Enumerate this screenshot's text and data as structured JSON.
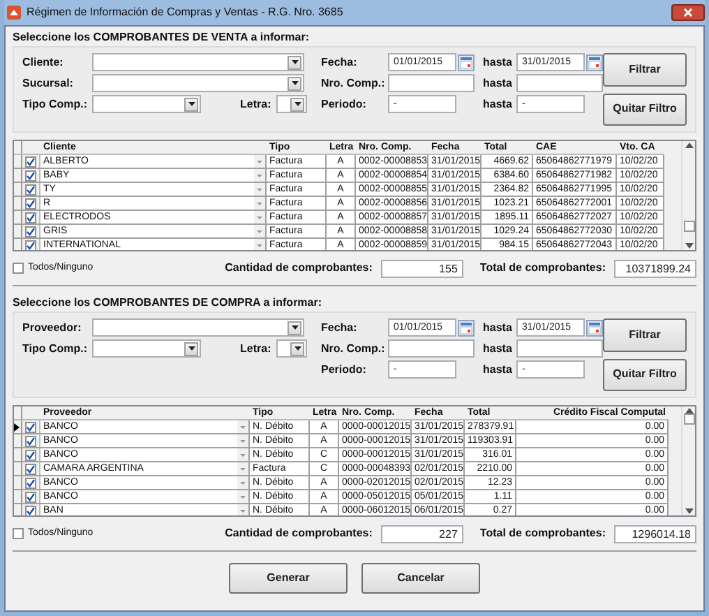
{
  "window": {
    "title": "Régimen de Información de Compras y Ventas - R.G. Nro. 3685"
  },
  "sections": [
    {
      "heading": "Seleccione los COMPROBANTES DE VENTA a informar:",
      "left_rows": [
        [
          {
            "label": "Cliente:",
            "kind": "wide"
          }
        ],
        [
          {
            "label": "Sucursal:",
            "kind": "wide"
          }
        ],
        [
          {
            "label": "Tipo Comp.:",
            "kind": "medium"
          },
          {
            "label": "Letra:",
            "kind": "small"
          }
        ]
      ],
      "ranges": [
        {
          "label": "Fecha:",
          "kind": "date",
          "from": "01/01/2015",
          "to_label": "hasta",
          "to": "31/01/2015"
        },
        {
          "label": "Nro. Comp.:",
          "kind": "text",
          "to_label": "hasta"
        },
        {
          "label": "Periodo:",
          "kind": "period",
          "from": "-",
          "to_label": "hasta",
          "to": "-"
        }
      ],
      "buttons": [
        "Filtrar",
        "Quitar Filtro"
      ],
      "table": {
        "columns": [
          "Cliente",
          "Tipo",
          "Letra",
          "Nro. Comp.",
          "Fecha",
          "Total",
          "CAE",
          "Vto. CA"
        ],
        "rows": [
          {
            "current": false,
            "checked": true,
            "cells": [
              "ALBERTO",
              "Factura",
              "A",
              "0002-00008853",
              "31/01/2015",
              "4669.62",
              "65064862771979",
              "10/02/20"
            ]
          },
          {
            "current": false,
            "checked": true,
            "cells": [
              "BABY",
              "Factura",
              "A",
              "0002-00008854",
              "31/01/2015",
              "6384.60",
              "65064862771982",
              "10/02/20"
            ]
          },
          {
            "current": false,
            "checked": true,
            "cells": [
              "TY",
              "Factura",
              "A",
              "0002-00008855",
              "31/01/2015",
              "2364.82",
              "65064862771995",
              "10/02/20"
            ]
          },
          {
            "current": false,
            "checked": true,
            "cells": [
              "R",
              "Factura",
              "A",
              "0002-00008856",
              "31/01/2015",
              "1023.21",
              "65064862772001",
              "10/02/20"
            ]
          },
          {
            "current": false,
            "checked": true,
            "cells": [
              "ELECTRODOS",
              "Factura",
              "A",
              "0002-00008857",
              "31/01/2015",
              "1895.11",
              "65064862772027",
              "10/02/20"
            ]
          },
          {
            "current": false,
            "checked": true,
            "cells": [
              "GRIS",
              "Factura",
              "A",
              "0002-00008858",
              "31/01/2015",
              "1029.24",
              "65064862772030",
              "10/02/20"
            ]
          },
          {
            "current": false,
            "checked": true,
            "cells": [
              "INTERNATIONAL",
              "Factura",
              "A",
              "0002-00008859",
              "31/01/2015",
              "984.15",
              "65064862772043",
              "10/02/20"
            ]
          }
        ]
      },
      "footer": {
        "all_label": "Todos/Ninguno",
        "all_checked": false,
        "count_label": "Cantidad de comprobantes:",
        "count": "155",
        "total_label": "Total de comprobantes:",
        "total": "10371899.24"
      }
    },
    {
      "heading": "Seleccione los COMPROBANTES DE COMPRA a informar:",
      "left_rows": [
        [
          {
            "label": "Proveedor:",
            "kind": "wide"
          }
        ],
        [
          {
            "label": "Tipo Comp.:",
            "kind": "medium"
          },
          {
            "label": "Letra:",
            "kind": "small"
          }
        ]
      ],
      "ranges": [
        {
          "label": "Fecha:",
          "kind": "date",
          "from": "01/01/2015",
          "to_label": "hasta",
          "to": "31/01/2015"
        },
        {
          "label": "Nro. Comp.:",
          "kind": "text",
          "to_label": "hasta"
        },
        {
          "label": "Periodo:",
          "kind": "period",
          "from": "-",
          "to_label": "hasta",
          "to": "-"
        }
      ],
      "buttons": [
        "Filtrar",
        "Quitar Filtro"
      ],
      "table": {
        "columns": [
          "Proveedor",
          "Tipo",
          "Letra",
          "Nro. Comp.",
          "Fecha",
          "Total",
          "Crédito Fiscal Computal"
        ],
        "rows": [
          {
            "current": true,
            "checked": true,
            "cells": [
              "BANCO",
              "N. Débito",
              "A",
              "0000-00012015",
              "31/01/2015",
              "278379.91",
              "0.00"
            ]
          },
          {
            "current": false,
            "checked": true,
            "cells": [
              "BANCO",
              "N. Débito",
              "A",
              "0000-00012015",
              "31/01/2015",
              "119303.91",
              "0.00"
            ]
          },
          {
            "current": false,
            "checked": true,
            "cells": [
              "BANCO",
              "N. Débito",
              "C",
              "0000-00012015",
              "31/01/2015",
              "316.01",
              "0.00"
            ]
          },
          {
            "current": false,
            "checked": true,
            "cells": [
              "CAMARA ARGENTINA",
              "Factura",
              "C",
              "0000-00048393",
              "02/01/2015",
              "2210.00",
              "0.00"
            ]
          },
          {
            "current": false,
            "checked": true,
            "cells": [
              "BANCO",
              "N. Débito",
              "A",
              "0000-02012015",
              "02/01/2015",
              "12.23",
              "0.00"
            ]
          },
          {
            "current": false,
            "checked": true,
            "cells": [
              "BANCO",
              "N. Débito",
              "A",
              "0000-05012015",
              "05/01/2015",
              "1.11",
              "0.00"
            ]
          },
          {
            "current": false,
            "checked": true,
            "cells": [
              "BAN",
              "N. Débito",
              "A",
              "0000-06012015",
              "06/01/2015",
              "0.27",
              "0.00"
            ]
          }
        ]
      },
      "footer": {
        "all_label": "Todos/Ninguno",
        "all_checked": false,
        "count_label": "Cantidad de comprobantes:",
        "count": "227",
        "total_label": "Total de comprobantes:",
        "total": "1296014.18"
      }
    }
  ],
  "actions": [
    "Generar",
    "Cancelar"
  ]
}
